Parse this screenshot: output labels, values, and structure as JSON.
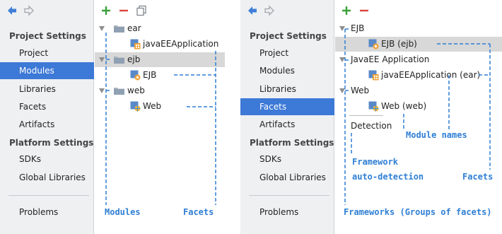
{
  "panel_modules": {
    "sidebar": {
      "project_settings_label": "Project Settings",
      "items_project": [
        {
          "label": "Project",
          "selected": false
        },
        {
          "label": "Modules",
          "selected": true
        },
        {
          "label": "Libraries",
          "selected": false
        },
        {
          "label": "Facets",
          "selected": false
        },
        {
          "label": "Artifacts",
          "selected": false
        }
      ],
      "platform_settings_label": "Platform Settings",
      "items_platform": [
        {
          "label": "SDKs",
          "selected": false
        },
        {
          "label": "Global Libraries",
          "selected": false
        }
      ],
      "problems_label": "Problems"
    },
    "tree": [
      {
        "label": "ear",
        "kind": "module-folder",
        "level": 0,
        "expanded": true,
        "selected": false
      },
      {
        "label": "javaEEApplication",
        "kind": "javaee-facet",
        "level": 1,
        "selected": false
      },
      {
        "label": "ejb",
        "kind": "module-folder",
        "level": 0,
        "expanded": true,
        "selected": true
      },
      {
        "label": "EJB",
        "kind": "ejb-facet",
        "level": 1,
        "selected": false
      },
      {
        "label": "web",
        "kind": "module-folder",
        "level": 0,
        "expanded": true,
        "selected": false
      },
      {
        "label": "Web",
        "kind": "web-facet",
        "level": 1,
        "selected": false
      }
    ],
    "annotations": {
      "modules": "Modules",
      "facets": "Facets"
    }
  },
  "panel_facets": {
    "sidebar": {
      "project_settings_label": "Project Settings",
      "items_project": [
        {
          "label": "Project",
          "selected": false
        },
        {
          "label": "Modules",
          "selected": false
        },
        {
          "label": "Libraries",
          "selected": false
        },
        {
          "label": "Facets",
          "selected": true
        },
        {
          "label": "Artifacts",
          "selected": false
        }
      ],
      "platform_settings_label": "Platform Settings",
      "items_platform": [
        {
          "label": "SDKs",
          "selected": false
        },
        {
          "label": "Global Libraries",
          "selected": false
        }
      ],
      "problems_label": "Problems"
    },
    "tree": [
      {
        "label": "EJB",
        "kind": "framework-group",
        "level": 0,
        "expanded": true,
        "selected": false
      },
      {
        "label": "EJB (ejb)",
        "kind": "ejb-facet",
        "level": 1,
        "selected": true
      },
      {
        "label": "JavaEE Application",
        "kind": "framework-group",
        "level": 0,
        "expanded": true,
        "selected": false
      },
      {
        "label": "javaEEApplication (ear)",
        "kind": "javaee-facet",
        "level": 1,
        "selected": false
      },
      {
        "label": "Web",
        "kind": "framework-group",
        "level": 0,
        "expanded": true,
        "selected": false
      },
      {
        "label": "Web (web)",
        "kind": "web-facet",
        "level": 1,
        "selected": false
      }
    ],
    "detection_label": "Detection",
    "annotations": {
      "module_names": "Module names",
      "framework_line1": "Framework",
      "framework_line2": "auto-detection",
      "facets": "Facets",
      "frameworks": "Frameworks (Groups of facets)"
    }
  },
  "colors": {
    "accent": "#3d79d6",
    "annotation": "#2f7fd4",
    "add_icon": "#3aa23a",
    "remove_icon": "#d9453b",
    "sidebar_bg": "#eef0f2",
    "row_selected": "#d8d8d8"
  },
  "icons": {
    "back": "arrow-left-icon",
    "forward": "arrow-right-icon",
    "add": "plus-icon",
    "remove": "minus-icon",
    "copy": "copy-icon"
  }
}
